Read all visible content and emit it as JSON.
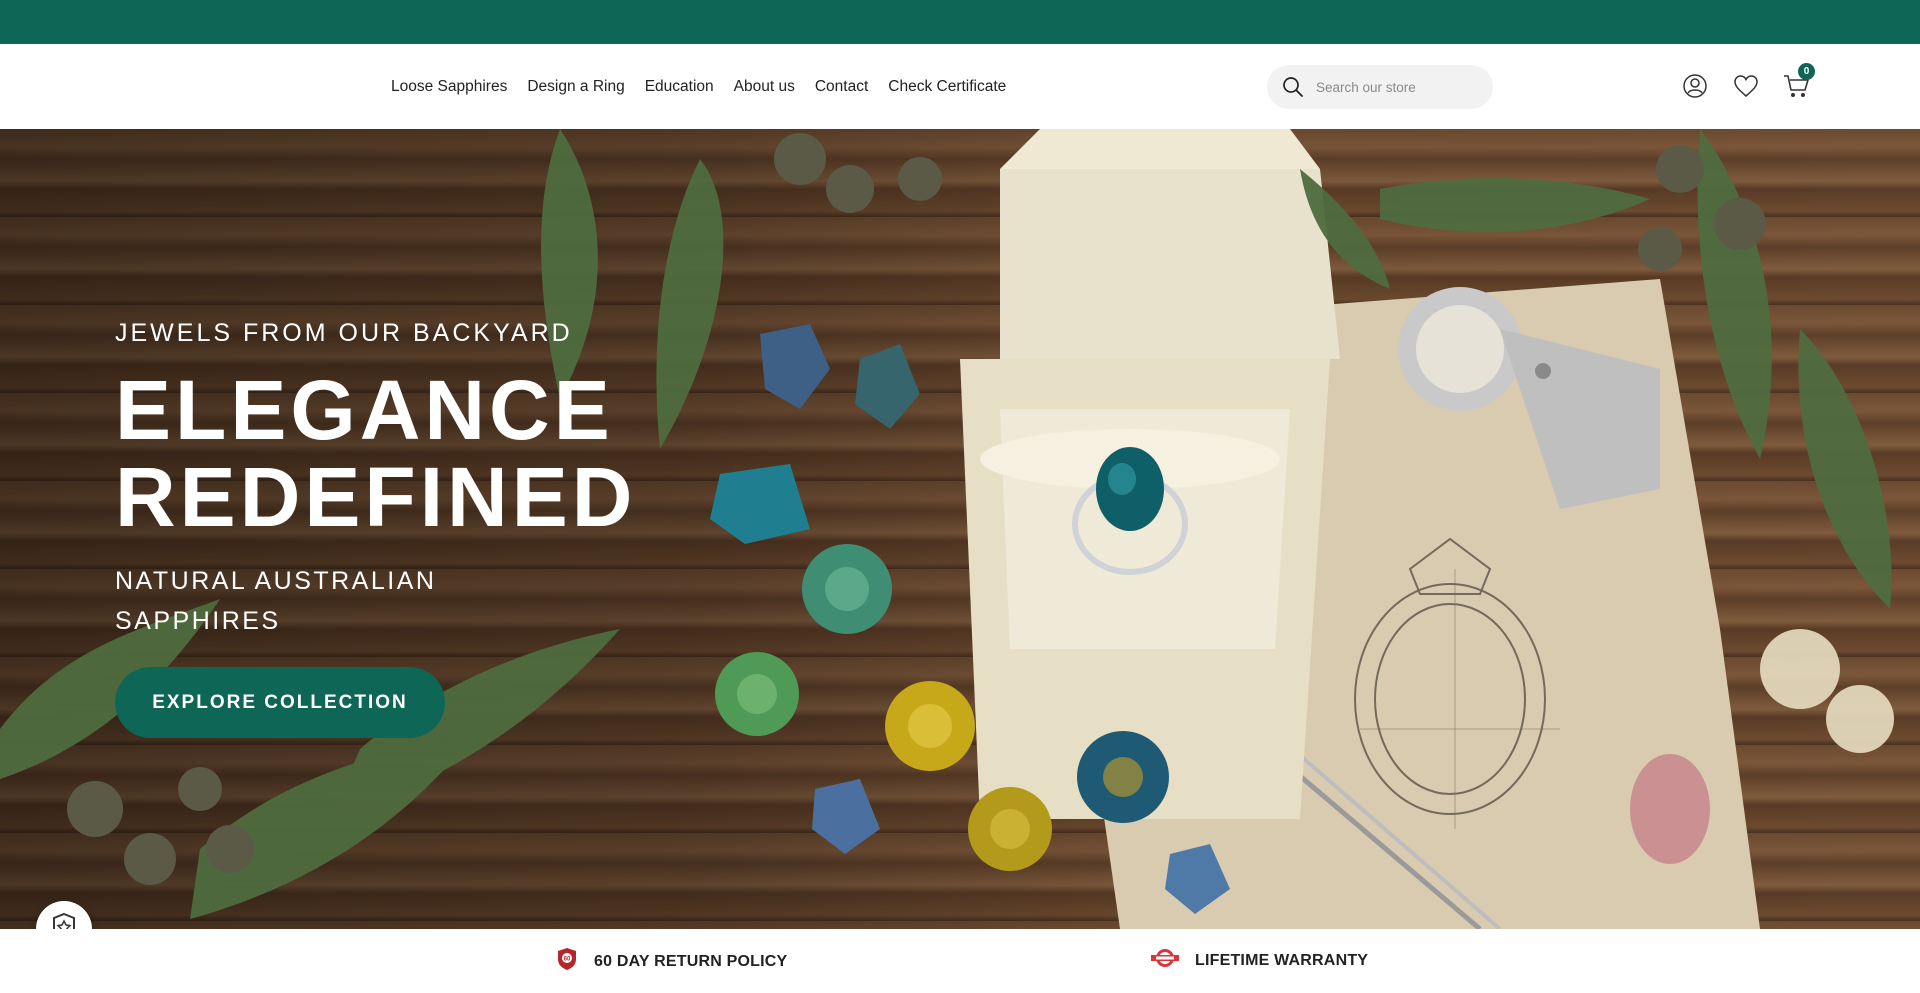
{
  "nav": {
    "items": [
      {
        "label": "Loose Sapphires"
      },
      {
        "label": "Design a Ring"
      },
      {
        "label": "Education"
      },
      {
        "label": "About us"
      },
      {
        "label": "Contact"
      },
      {
        "label": "Check Certificate"
      }
    ]
  },
  "search": {
    "placeholder": "Search our store",
    "icon": "search-icon"
  },
  "header_icons": {
    "account": "user-icon",
    "wishlist": "heart-icon",
    "cart": "cart-icon",
    "cart_count": "0"
  },
  "hero": {
    "eyebrow": "JEWELS FROM OUR BACKYARD",
    "headline_line1": "ELEGANCE",
    "headline_line2": "REDEFINED",
    "subheading": "NATURAL AUSTRALIAN SAPPHIRES",
    "cta_label": "EXPLORE COLLECTION"
  },
  "features": [
    {
      "label": "60 DAY RETURN POLICY",
      "icon": "return-policy-icon"
    },
    {
      "label": "LIFETIME WARRANTY",
      "icon": "warranty-icon"
    }
  ],
  "colors": {
    "brand": "#0e6657",
    "topbar": "#0e6657",
    "text": "#222222"
  }
}
